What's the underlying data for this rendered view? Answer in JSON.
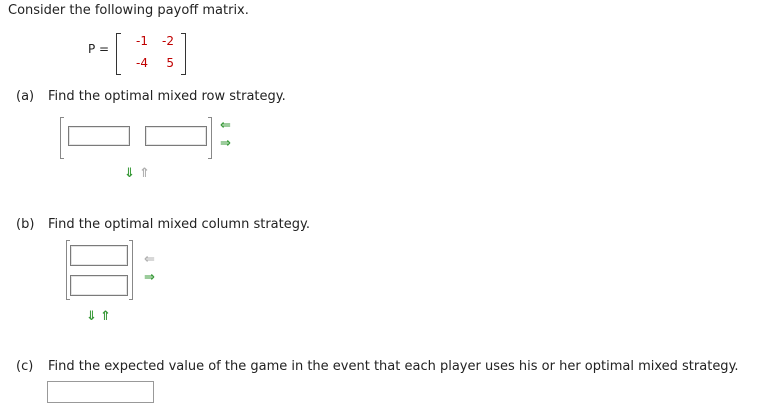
{
  "intro": "Consider the following payoff matrix.",
  "matrix": {
    "label": "P =",
    "rows": [
      [
        "-1",
        "-2"
      ],
      [
        "-4",
        "5"
      ]
    ]
  },
  "parts": {
    "a": {
      "tag": "(a)",
      "text": "Find the optimal mixed row strategy."
    },
    "b": {
      "tag": "(b)",
      "text": "Find the optimal mixed column strategy."
    },
    "c": {
      "tag": "(c)",
      "text": "Find the expected value of the game in the event that each player uses his or her optimal mixed strategy."
    }
  },
  "inputs": {
    "row_strategy": [
      "",
      ""
    ],
    "col_strategy": [
      "",
      ""
    ],
    "expected_value": ""
  },
  "icons": {
    "shrink_columns": "left-arrow-icon",
    "grow_columns": "right-arrow-icon",
    "grow_rows": "down-arrow-icon",
    "shrink_rows": "up-arrow-icon"
  },
  "glyphs": {
    "left": "⇐",
    "right": "⇒",
    "down": "⇓",
    "up": "⇑"
  },
  "colors": {
    "matrix_entries": "#c00000",
    "active_arrow": "#3a9a3a",
    "inactive_arrow": "#b0b0b0"
  }
}
